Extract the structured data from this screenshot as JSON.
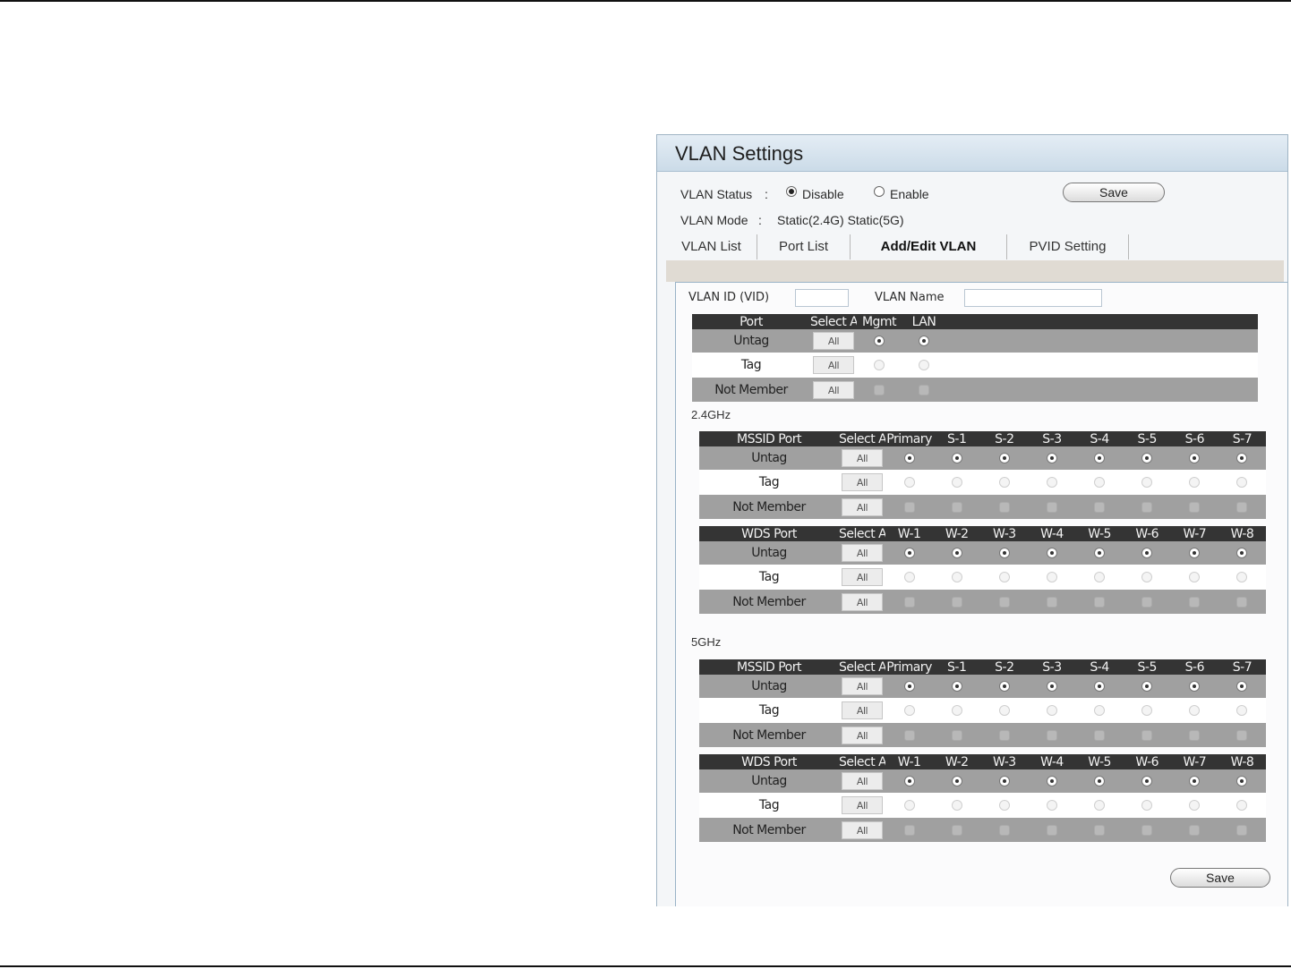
{
  "page": {
    "title": "VLAN Settings"
  },
  "status": {
    "vlan_status_label": "VLAN Status",
    "sep": ":",
    "disable_label": "Disable",
    "enable_label": "Enable",
    "selected": "Disable",
    "save_label": "Save",
    "vlan_mode_label": "VLAN Mode",
    "vlan_mode_value": "Static(2.4G)  Static(5G)"
  },
  "tabs": [
    {
      "label": "VLAN List"
    },
    {
      "label": "Port List"
    },
    {
      "label": "Add/Edit VLAN",
      "active": true
    },
    {
      "label": "PVID Setting"
    }
  ],
  "form": {
    "vlan_id_label": "VLAN ID (VID)",
    "vlan_id_value": "",
    "vlan_name_label": "VLAN Name",
    "vlan_name_value": ""
  },
  "port_table": {
    "headers": [
      "Port",
      "Select All",
      "Mgmt",
      "LAN"
    ],
    "rows": [
      {
        "label": "Untag",
        "all": "All",
        "state": "on"
      },
      {
        "label": "Tag",
        "all": "All",
        "state": "off"
      },
      {
        "label": "Not Member",
        "all": "All",
        "state": "dim"
      }
    ]
  },
  "band_24": {
    "label": "2.4GHz",
    "mssid_headers": [
      "MSSID Port",
      "Select All",
      "Primary",
      "S-1",
      "S-2",
      "S-3",
      "S-4",
      "S-5",
      "S-6",
      "S-7"
    ],
    "wds_headers": [
      "WDS Port",
      "Select All",
      "W-1",
      "W-2",
      "W-3",
      "W-4",
      "W-5",
      "W-6",
      "W-7",
      "W-8"
    ],
    "rows": [
      {
        "label": "Untag",
        "all": "All"
      },
      {
        "label": "Tag",
        "all": "All"
      },
      {
        "label": "Not Member",
        "all": "All"
      }
    ]
  },
  "band_5": {
    "label": "5GHz",
    "mssid_headers": [
      "MSSID Port",
      "Select All",
      "Primary",
      "S-1",
      "S-2",
      "S-3",
      "S-4",
      "S-5",
      "S-6",
      "S-7"
    ],
    "wds_headers": [
      "WDS Port",
      "Select All",
      "W-1",
      "W-2",
      "W-3",
      "W-4",
      "W-5",
      "W-6",
      "W-7",
      "W-8"
    ],
    "rows": [
      {
        "label": "Untag",
        "all": "All"
      },
      {
        "label": "Tag",
        "all": "All"
      },
      {
        "label": "Not Member",
        "all": "All"
      }
    ]
  },
  "footer": {
    "save_label": "Save"
  },
  "colors": {
    "header_bg": "#343434",
    "row_gray": "#a0a0a0",
    "title_bar": "#cbdbe8"
  }
}
